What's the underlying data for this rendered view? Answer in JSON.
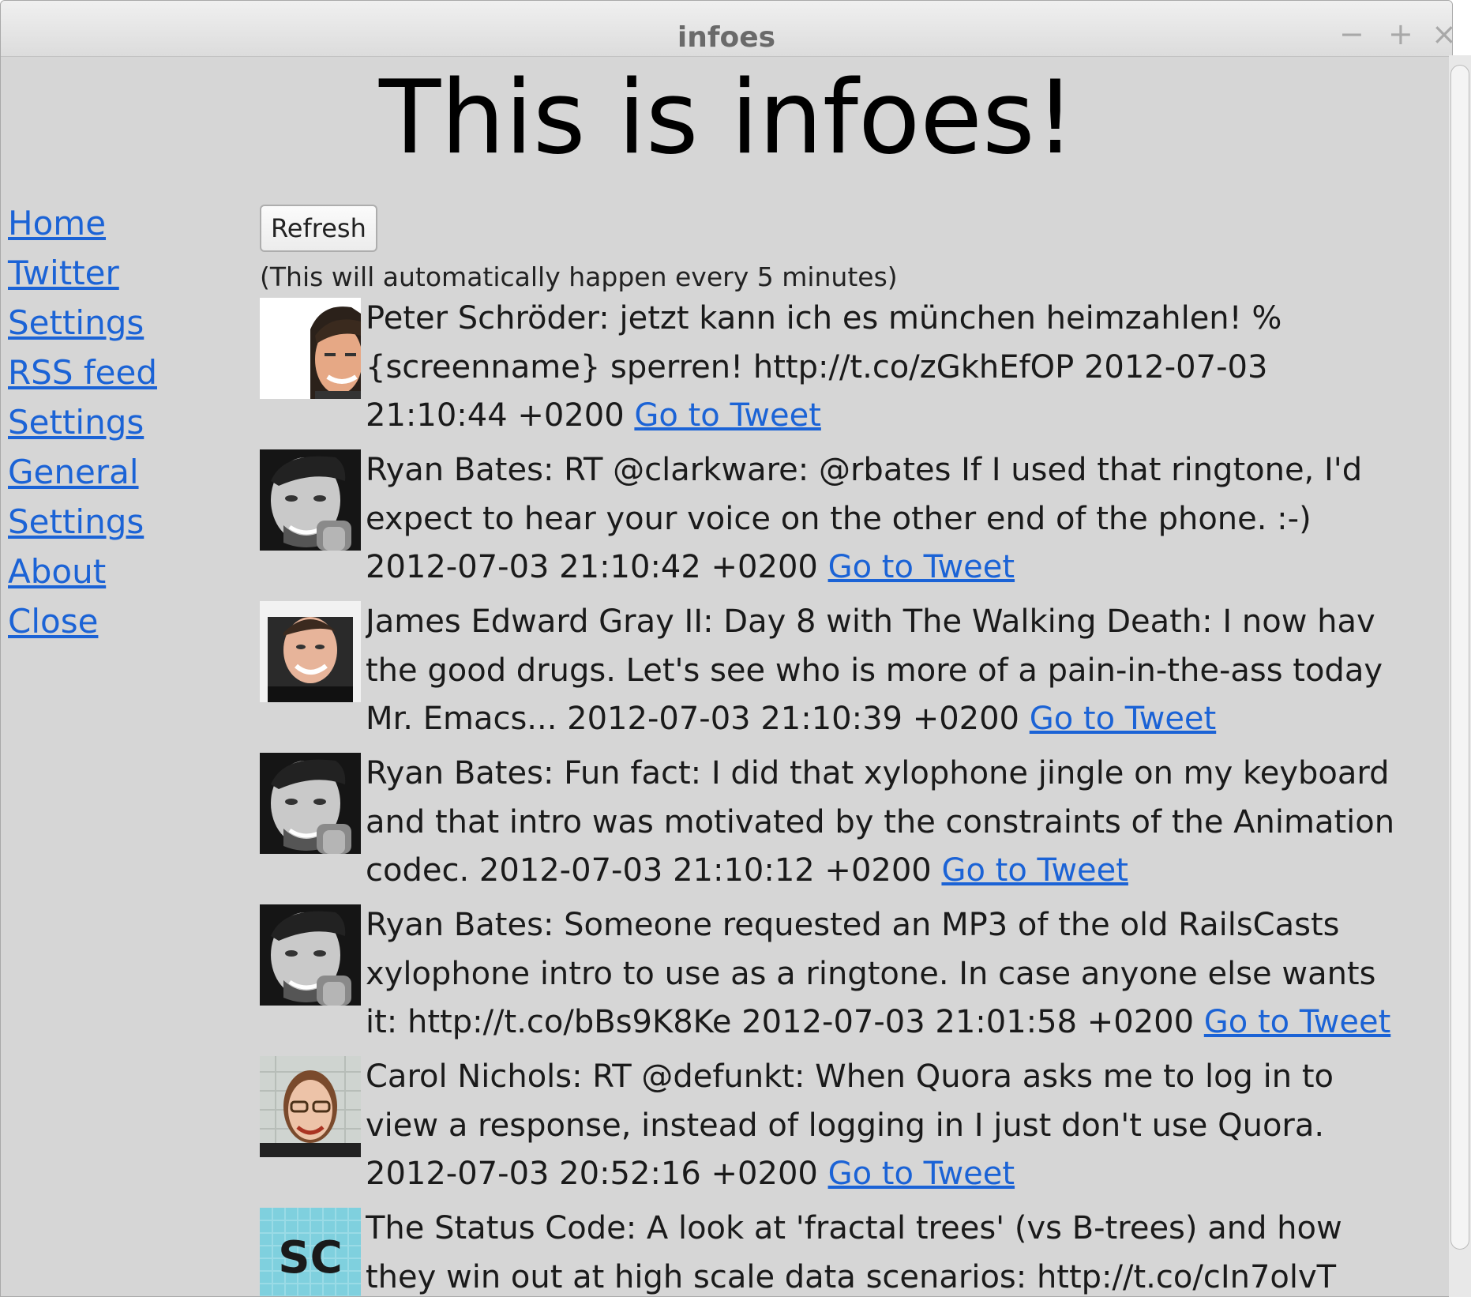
{
  "window": {
    "title": "infoes",
    "controls": {
      "minimize": "−",
      "maximize": "+",
      "close": "×"
    }
  },
  "page": {
    "heading": "This is infoes!"
  },
  "sidebar": {
    "items": [
      {
        "label": "Home"
      },
      {
        "label": "Twitter"
      },
      {
        "label": "Settings"
      },
      {
        "label": "RSS feed"
      },
      {
        "label": "Settings"
      },
      {
        "label": "General"
      },
      {
        "label": "Settings"
      },
      {
        "label": "About"
      },
      {
        "label": "Close"
      }
    ]
  },
  "content": {
    "refresh_label": "Refresh",
    "refresh_note": "(This will automatically happen every 5 minutes)"
  },
  "tweets": [
    {
      "avatar": "avatar-peter-schroeder",
      "lines": [
        "Peter Schröder: jetzt kann ich es münchen heimzahlen! %",
        "{screenname} sperren! http://t.co/zGkhEfOP 2012-07-03",
        "21:10:44 +0200 "
      ],
      "link": "Go to Tweet"
    },
    {
      "avatar": "avatar-ryan-bates",
      "lines": [
        "Ryan Bates: RT @clarkware: @rbates If I used that ringtone, I'd",
        "expect to hear your voice on the other end of the phone. :-)",
        "2012-07-03 21:10:42 +0200 "
      ],
      "link": "Go to Tweet"
    },
    {
      "avatar": "avatar-james-edward-gray",
      "lines": [
        "James Edward Gray II: Day 8 with The Walking Death:  I now hav",
        "the good drugs.  Let's see who is more of a pain-in-the-ass today",
        "Mr. Emacs... 2012-07-03 21:10:39 +0200 "
      ],
      "link": "Go to Tweet"
    },
    {
      "avatar": "avatar-ryan-bates",
      "lines": [
        "Ryan Bates: Fun fact: I did that xylophone jingle on my keyboard",
        "and that intro was motivated by the constraints of the Animation",
        "codec. 2012-07-03 21:10:12 +0200 "
      ],
      "link": "Go to Tweet"
    },
    {
      "avatar": "avatar-ryan-bates",
      "lines": [
        "Ryan Bates: Someone requested an MP3 of the old RailsCasts",
        "xylophone intro to use as a ringtone. In case anyone else wants",
        "it: http://t.co/bBs9K8Ke 2012-07-03 21:01:58 +0200 "
      ],
      "link": "Go to Tweet"
    },
    {
      "avatar": "avatar-carol-nichols",
      "lines": [
        "Carol Nichols: RT @defunkt: When Quora asks me to log in to",
        "view a response, instead of logging in I just don't use Quora.",
        "2012-07-03 20:52:16 +0200 "
      ],
      "link": "Go to Tweet"
    },
    {
      "avatar": "avatar-the-status-code",
      "avatar_text": "SC",
      "lines": [
        "The Status Code: A look at 'fractal trees' (vs B-trees) and how",
        "they win out at high scale data scenarios: http://t.co/cIn7olvT"
      ],
      "link": ""
    }
  ]
}
